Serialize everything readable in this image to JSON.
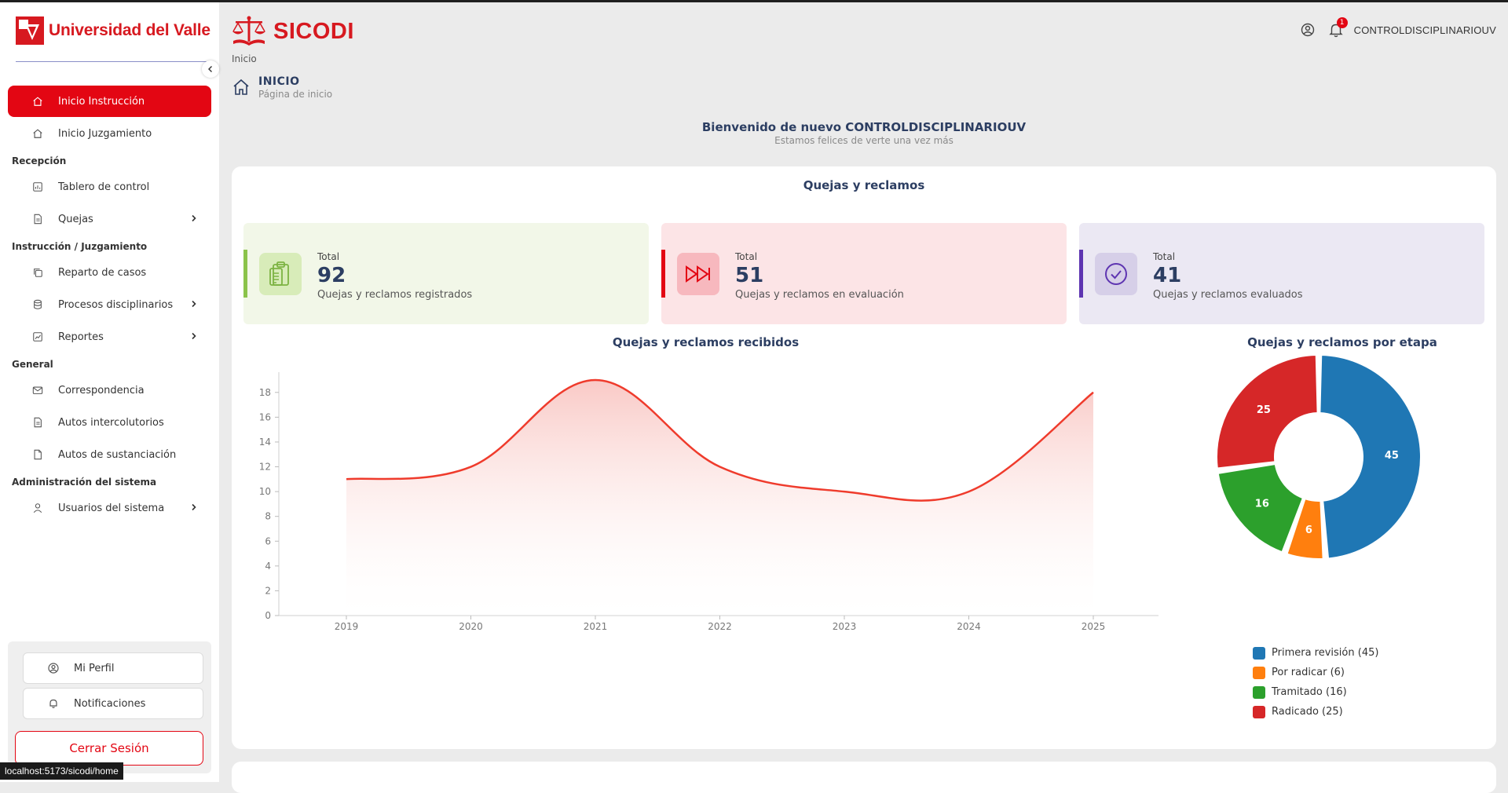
{
  "brand": {
    "university": "Universidad del Valle",
    "app": "SICODI"
  },
  "colors": {
    "accent": "#e30613",
    "navy": "#2c3e62",
    "line": "#ef3b2c"
  },
  "sidebar": {
    "items": [
      {
        "label": "Inicio Instrucción",
        "icon": "home-icon",
        "active": true
      },
      {
        "label": "Inicio Juzgamiento",
        "icon": "home-icon"
      }
    ],
    "sections": [
      {
        "title": "Recepción",
        "items": [
          {
            "label": "Tablero de control",
            "icon": "dashboard-icon"
          },
          {
            "label": "Quejas",
            "icon": "document-icon",
            "chevron": true
          }
        ]
      },
      {
        "title": "Instrucción / Juzgamiento",
        "items": [
          {
            "label": "Reparto de casos",
            "icon": "copy-icon"
          },
          {
            "label": "Procesos disciplinarios",
            "icon": "database-icon",
            "chevron": true
          },
          {
            "label": "Reportes",
            "icon": "chart-icon",
            "chevron": true
          }
        ]
      },
      {
        "title": "General",
        "items": [
          {
            "label": "Correspondencia",
            "icon": "mail-icon"
          },
          {
            "label": "Autos intercolutorios",
            "icon": "document-icon"
          },
          {
            "label": "Autos de sustanciación",
            "icon": "file-icon"
          }
        ]
      },
      {
        "title": "Administración del sistema",
        "items": [
          {
            "label": "Usuarios del sistema",
            "icon": "user-icon",
            "chevron": true
          }
        ]
      }
    ],
    "profile_label": "Mi Perfil",
    "notifications_label": "Notificaciones",
    "logout_label": "Cerrar Sesión"
  },
  "status_url": "localhost:5173/sicodi/home",
  "header": {
    "crumb": "Inicio",
    "user": "CONTROLDISCIPLINARIOUV",
    "notif_count": "1"
  },
  "page": {
    "title": "INICIO",
    "subtitle": "Página de inicio"
  },
  "welcome": {
    "line1": "Bienvenido de nuevo CONTROLDISCIPLINARIOUV",
    "line2": "Estamos felices de verte una vez más"
  },
  "panel": {
    "title": "Quejas y reclamos",
    "cards": [
      {
        "label": "Total",
        "value": "92",
        "desc": "Quejas y reclamos registrados",
        "bg": "#f2f7e8",
        "bar": "#8bc34a",
        "iconbg": "#d8ecb9",
        "iconcolor": "#7cb342"
      },
      {
        "label": "Total",
        "value": "51",
        "desc": "Quejas y reclamos en evaluación",
        "bg": "#fce4e6",
        "bar": "#e30613",
        "iconbg": "#f7b8be",
        "iconcolor": "#e30613"
      },
      {
        "label": "Total",
        "value": "41",
        "desc": "Quejas y reclamos evaluados",
        "bg": "#ebe8f3",
        "bar": "#5e35b1",
        "iconbg": "#d6cfe8",
        "iconcolor": "#5e35b1"
      }
    ]
  },
  "chart_data": [
    {
      "type": "area",
      "title": "Quejas y reclamos recibidos",
      "x": [
        "2019",
        "2020",
        "2021",
        "2022",
        "2023",
        "2024",
        "2025"
      ],
      "values": [
        11,
        12,
        19,
        12,
        10,
        10,
        18
      ],
      "ylim": [
        0,
        19
      ],
      "yticks": [
        "0",
        "2",
        "4",
        "6",
        "8",
        "10",
        "12",
        "14",
        "16",
        "18"
      ],
      "xlabel": "",
      "ylabel": "",
      "grid": false,
      "legend": "none"
    },
    {
      "type": "pie",
      "title": "Quejas y reclamos por etapa",
      "labels": [
        "Primera revisión",
        "Por radicar",
        "Tramitado",
        "Radicado"
      ],
      "legend_labels": [
        "Primera revisión (45)",
        "Por radicar (6)",
        "Tramitado (16)",
        "Radicado (25)"
      ],
      "values": [
        45,
        6,
        16,
        25
      ],
      "value_labels": [
        "45",
        "6",
        "16",
        "25"
      ],
      "colors": [
        "#1f77b4",
        "#ff7f0e",
        "#2ca02c",
        "#d62728"
      ],
      "legend": "bottom"
    }
  ]
}
